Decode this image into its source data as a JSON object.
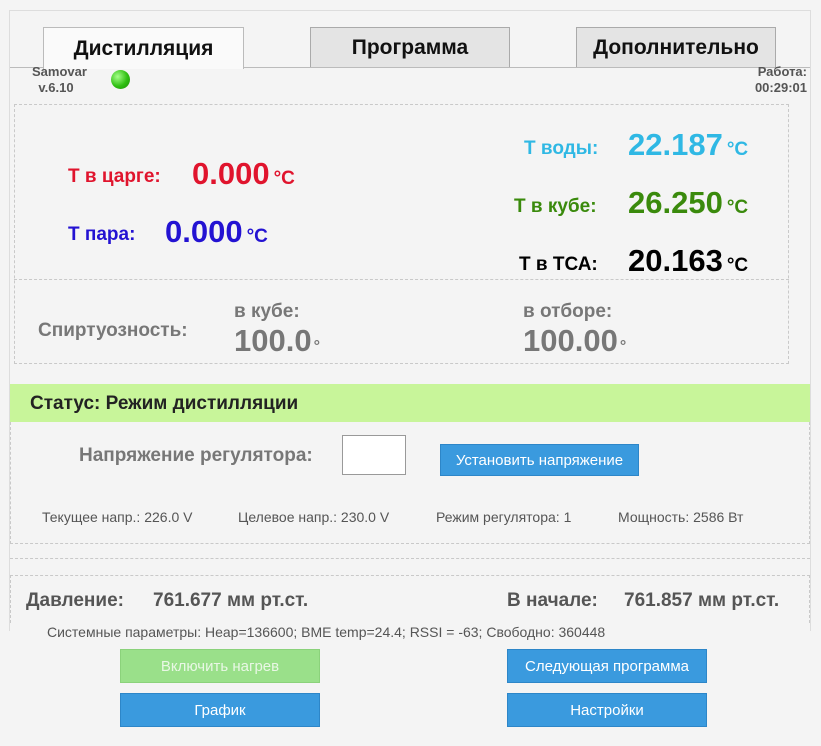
{
  "tabs": [
    {
      "label": "Дистилляция",
      "active": true
    },
    {
      "label": "Программа",
      "active": false
    },
    {
      "label": "Дополнительно",
      "active": false
    }
  ],
  "header": {
    "app_name": "Samovar",
    "version": "v.6.10",
    "status_led_color": "#2fbf12",
    "work_label": "Работа:",
    "work_time": "00:29:01"
  },
  "temps": {
    "unit": "°C",
    "t_column": {
      "label": "Т в царге:",
      "value": "0.000",
      "color": "#e0142d"
    },
    "t_steam": {
      "label": "Т пара:",
      "value": "0.000",
      "color": "#2312d2"
    },
    "t_water": {
      "label": "Т воды:",
      "value": "22.187",
      "color": "#2fb8e4"
    },
    "t_cube": {
      "label": "Т в кубе:",
      "value": "26.250",
      "color": "#3a8a0c"
    },
    "t_tsa": {
      "label": "Т в ТСА:",
      "value": "20.163",
      "color": "#000000"
    }
  },
  "alcohol": {
    "label": "Спиртуозность:",
    "cube_label": "в кубе:",
    "cube_value": "100.0",
    "take_label": "в отборе:",
    "take_value": "100.00",
    "degree": "°"
  },
  "status": {
    "text": "Статус: Режим дистилляции",
    "color": "#c8f59a"
  },
  "regulator": {
    "label": "Напряжение регулятора:",
    "input_value": "",
    "set_button": "Установить напряжение",
    "current": "Текущее напр.: 226.0 V",
    "target": "Целевое напр.: 230.0 V",
    "mode": "Режим регулятора: 1",
    "power": "Мощность: 2586 Вт"
  },
  "pressure": {
    "label": "Давление:",
    "value": "761.677 мм рт.ст.",
    "start_label": "В начале:",
    "start_value": "761.857 мм рт.ст."
  },
  "system_params": "Системные параметры: Heap=136600; BME temp=24.4; RSSI = -63; Свободно: 360448",
  "buttons": {
    "heat": "Включить нагрев",
    "next_program": "Следующая программа",
    "chart": "График",
    "settings": "Настройки"
  }
}
